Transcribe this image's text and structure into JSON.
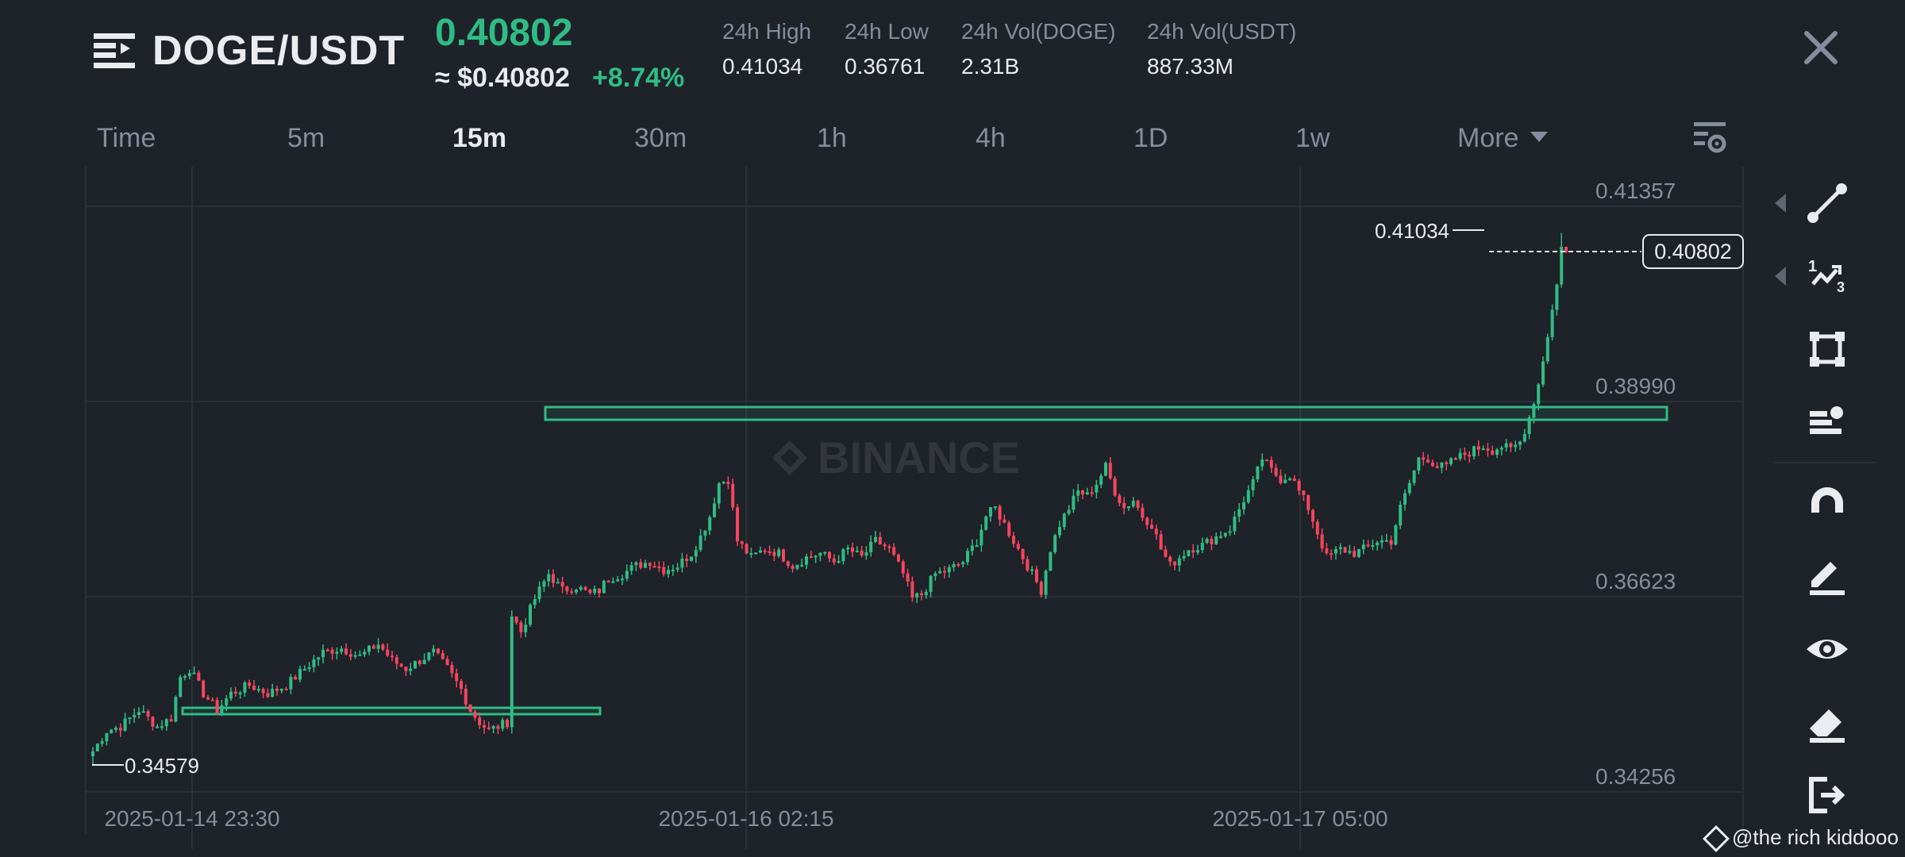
{
  "header": {
    "pair": "DOGE/USDT",
    "last_price": "0.40802",
    "usd_price": "≈ $0.40802",
    "change_pct": "+8.74%",
    "stats": [
      {
        "label": "24h High",
        "value": "0.41034"
      },
      {
        "label": "24h Low",
        "value": "0.36761"
      },
      {
        "label": "24h Vol(DOGE)",
        "value": "2.31B"
      },
      {
        "label": "24h Vol(USDT)",
        "value": "887.33M"
      }
    ]
  },
  "timeframes": {
    "items": [
      "Time",
      "5m",
      "15m",
      "30m",
      "1h",
      "4h",
      "1D",
      "1w",
      "More"
    ],
    "active": "15m"
  },
  "chart": {
    "y_labels": [
      "0.41357",
      "0.38990",
      "0.36623",
      "0.34256"
    ],
    "x_labels": [
      "2025-01-14 23:30",
      "2025-01-16 02:15",
      "2025-01-17 05:00"
    ],
    "high_marker": "0.41034",
    "low_marker": "0.34579",
    "current_price_tag": "0.40802",
    "watermark_logo_text": "BINANCE"
  },
  "chart_data": {
    "type": "candlestick",
    "y_range": [
      0.34256,
      0.41357
    ],
    "x_start": "2025-01-14 21:45",
    "interval": "15m",
    "path": [
      [
        0,
        0.3475
      ],
      [
        3,
        0.35
      ],
      [
        6,
        0.3505
      ],
      [
        10,
        0.3525
      ],
      [
        14,
        0.3505
      ],
      [
        17,
        0.3515
      ],
      [
        19,
        0.3565
      ],
      [
        21,
        0.3575
      ],
      [
        24,
        0.3545
      ],
      [
        27,
        0.3525
      ],
      [
        30,
        0.3545
      ],
      [
        34,
        0.3555
      ],
      [
        38,
        0.3545
      ],
      [
        42,
        0.3555
      ],
      [
        46,
        0.3575
      ],
      [
        50,
        0.3595
      ],
      [
        54,
        0.36
      ],
      [
        58,
        0.359
      ],
      [
        62,
        0.3605
      ],
      [
        65,
        0.3585
      ],
      [
        68,
        0.3575
      ],
      [
        71,
        0.3585
      ],
      [
        74,
        0.3595
      ],
      [
        77,
        0.3575
      ],
      [
        80,
        0.355
      ],
      [
        82,
        0.3525
      ],
      [
        84,
        0.351
      ],
      [
        86,
        0.35
      ],
      [
        88,
        0.3505
      ],
      [
        90,
        0.351
      ],
      [
        91,
        0.364
      ],
      [
        93,
        0.362
      ],
      [
        96,
        0.366
      ],
      [
        99,
        0.369
      ],
      [
        102,
        0.367
      ],
      [
        105,
        0.3675
      ],
      [
        108,
        0.3665
      ],
      [
        110,
        0.367
      ],
      [
        112,
        0.3685
      ],
      [
        115,
        0.369
      ],
      [
        118,
        0.37
      ],
      [
        121,
        0.3705
      ],
      [
        124,
        0.3695
      ],
      [
        127,
        0.37
      ],
      [
        130,
        0.3715
      ],
      [
        132,
        0.3735
      ],
      [
        134,
        0.376
      ],
      [
        136,
        0.38
      ],
      [
        138,
        0.3805
      ],
      [
        140,
        0.373
      ],
      [
        143,
        0.371
      ],
      [
        146,
        0.372
      ],
      [
        149,
        0.3715
      ],
      [
        152,
        0.37
      ],
      [
        155,
        0.371
      ],
      [
        158,
        0.3715
      ],
      [
        161,
        0.3705
      ],
      [
        164,
        0.372
      ],
      [
        167,
        0.371
      ],
      [
        170,
        0.373
      ],
      [
        173,
        0.372
      ],
      [
        176,
        0.369
      ],
      [
        178,
        0.366
      ],
      [
        180,
        0.3665
      ],
      [
        183,
        0.369
      ],
      [
        186,
        0.3695
      ],
      [
        189,
        0.3705
      ],
      [
        192,
        0.373
      ],
      [
        194,
        0.376
      ],
      [
        196,
        0.377
      ],
      [
        198,
        0.375
      ],
      [
        200,
        0.373
      ],
      [
        202,
        0.371
      ],
      [
        204,
        0.369
      ],
      [
        206,
        0.367
      ],
      [
        208,
        0.372
      ],
      [
        210,
        0.375
      ],
      [
        212,
        0.377
      ],
      [
        214,
        0.379
      ],
      [
        216,
        0.3785
      ],
      [
        218,
        0.38
      ],
      [
        220,
        0.382
      ],
      [
        222,
        0.379
      ],
      [
        224,
        0.377
      ],
      [
        226,
        0.378
      ],
      [
        228,
        0.376
      ],
      [
        230,
        0.375
      ],
      [
        232,
        0.372
      ],
      [
        234,
        0.37
      ],
      [
        236,
        0.371
      ],
      [
        238,
        0.372
      ],
      [
        241,
        0.3725
      ],
      [
        244,
        0.3735
      ],
      [
        247,
        0.3745
      ],
      [
        250,
        0.378
      ],
      [
        252,
        0.38
      ],
      [
        254,
        0.383
      ],
      [
        256,
        0.3815
      ],
      [
        258,
        0.3805
      ],
      [
        260,
        0.381
      ],
      [
        262,
        0.379
      ],
      [
        264,
        0.377
      ],
      [
        266,
        0.374
      ],
      [
        268,
        0.371
      ],
      [
        271,
        0.372
      ],
      [
        274,
        0.3715
      ],
      [
        276,
        0.372
      ],
      [
        279,
        0.373
      ],
      [
        282,
        0.373
      ],
      [
        284,
        0.377
      ],
      [
        286,
        0.38
      ],
      [
        288,
        0.383
      ],
      [
        290,
        0.383
      ],
      [
        292,
        0.382
      ],
      [
        294,
        0.382
      ],
      [
        296,
        0.383
      ],
      [
        298,
        0.3835
      ],
      [
        300,
        0.384
      ],
      [
        302,
        0.3845
      ],
      [
        304,
        0.384
      ],
      [
        306,
        0.3845
      ],
      [
        308,
        0.384
      ],
      [
        310,
        0.385
      ],
      [
        312,
        0.388
      ],
      [
        314,
        0.392
      ],
      [
        316,
        0.398
      ],
      [
        318,
        0.404
      ],
      [
        319,
        0.409
      ],
      [
        320,
        0.408
      ]
    ],
    "high": 0.41034,
    "low": 0.34579,
    "last": 0.40802,
    "resistance_zone": [
      0.3882,
      0.389
    ],
    "support_zone": [
      0.3523,
      0.3529
    ]
  },
  "tools": [
    "trend-line-icon",
    "fib-icon",
    "rectangle-icon",
    "indicator-list-icon",
    "magnet-icon",
    "pencil-icon",
    "eye-icon",
    "eraser-icon",
    "exit-icon"
  ],
  "watermark": "@the rich kiddooo",
  "colors": {
    "up": "#2ebd85",
    "down": "#f6465d",
    "bg": "#1e2229",
    "grid": "#2b3139",
    "axis": "#848e9c"
  }
}
